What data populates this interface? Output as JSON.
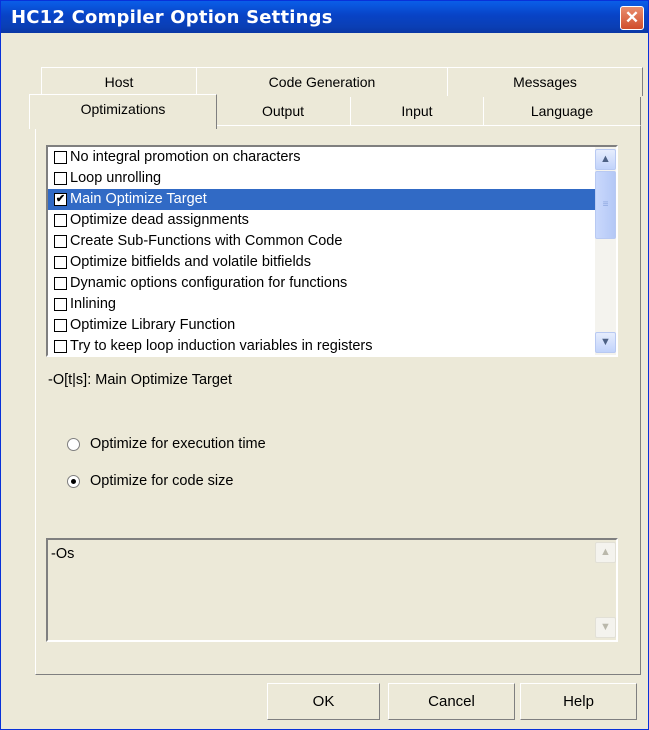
{
  "window": {
    "title": "HC12 Compiler Option Settings",
    "close_glyph": "✕"
  },
  "tabs": {
    "back_row": [
      {
        "label": "Host"
      },
      {
        "label": "Code Generation"
      },
      {
        "label": "Messages"
      }
    ],
    "front_row": [
      {
        "label": "Optimizations",
        "selected": true
      },
      {
        "label": "Output"
      },
      {
        "label": "Input"
      },
      {
        "label": "Language"
      }
    ]
  },
  "options_list": {
    "items": [
      {
        "label": "No integral promotion on characters",
        "checked": false,
        "selected": false
      },
      {
        "label": "Loop unrolling",
        "checked": false,
        "selected": false
      },
      {
        "label": "Main Optimize Target",
        "checked": true,
        "selected": true
      },
      {
        "label": "Optimize dead assignments",
        "checked": false,
        "selected": false
      },
      {
        "label": "Create Sub-Functions with Common Code",
        "checked": false,
        "selected": false
      },
      {
        "label": "Optimize bitfields and volatile bitfields",
        "checked": false,
        "selected": false
      },
      {
        "label": "Dynamic options configuration for functions",
        "checked": false,
        "selected": false
      },
      {
        "label": "Inlining",
        "checked": false,
        "selected": false
      },
      {
        "label": "Optimize Library Function",
        "checked": false,
        "selected": false
      },
      {
        "label": "Try to keep loop induction variables in registers",
        "checked": false,
        "selected": false
      }
    ],
    "check_glyph": "✔"
  },
  "description": "-O[t|s]: Main Optimize Target",
  "radios": [
    {
      "label": "Optimize for execution time",
      "checked": false
    },
    {
      "label": "Optimize for code size",
      "checked": true
    }
  ],
  "command_line": {
    "value": "-Os"
  },
  "buttons": {
    "ok": "OK",
    "cancel": "Cancel",
    "help": "Help"
  },
  "colors": {
    "titlebar": "#0a4fd6",
    "selection": "#316ac5",
    "dialog_bg": "#ece9d8"
  }
}
